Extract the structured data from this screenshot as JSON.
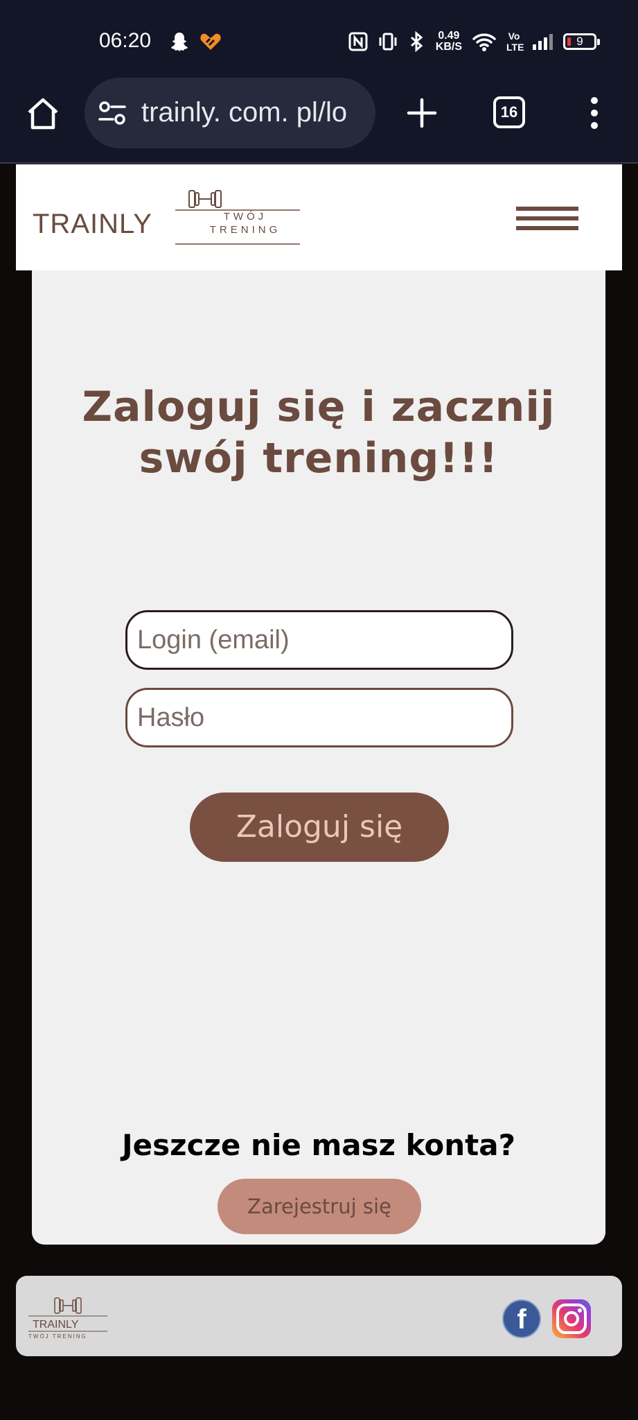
{
  "status_bar": {
    "time": "06:20",
    "speed_value": "0.49",
    "speed_unit": "KB/S",
    "volte": "Vo LTE",
    "battery": "9"
  },
  "browser": {
    "url": "trainly. com. pl/lo",
    "tab_count": "16"
  },
  "header": {
    "logo_main": "TRAINLY",
    "logo_sub_1": "TWÓJ",
    "logo_sub_2": "TRENING"
  },
  "login": {
    "title_line1": "Zaloguj się i zacznij",
    "title_line2": "swój trening!!!",
    "email_placeholder": "Login (email)",
    "password_placeholder": "Hasło",
    "submit_label": "Zaloguj się",
    "no_account_text": "Jeszcze nie masz konta?",
    "register_label": "Zarejestruj się"
  },
  "footer": {
    "logo_main": "TRAINLY",
    "logo_sub": "TWÓJ TRENING",
    "facebook_label": "f"
  },
  "colors": {
    "brand_brown": "#6b4a3f",
    "button_brown": "#7a5043",
    "register_pink": "#c28b7c",
    "card_bg": "#f0f0f0"
  },
  "icons": [
    "snapchat-icon",
    "heart-app-icon",
    "nfc-icon",
    "vibrate-icon",
    "bluetooth-icon",
    "wifi-icon",
    "signal-icon",
    "battery-icon",
    "home-icon",
    "site-settings-icon",
    "new-tab-icon",
    "tabs-icon",
    "overflow-menu-icon",
    "dumbbell-icon",
    "hamburger-menu-icon",
    "facebook-icon",
    "instagram-icon"
  ]
}
